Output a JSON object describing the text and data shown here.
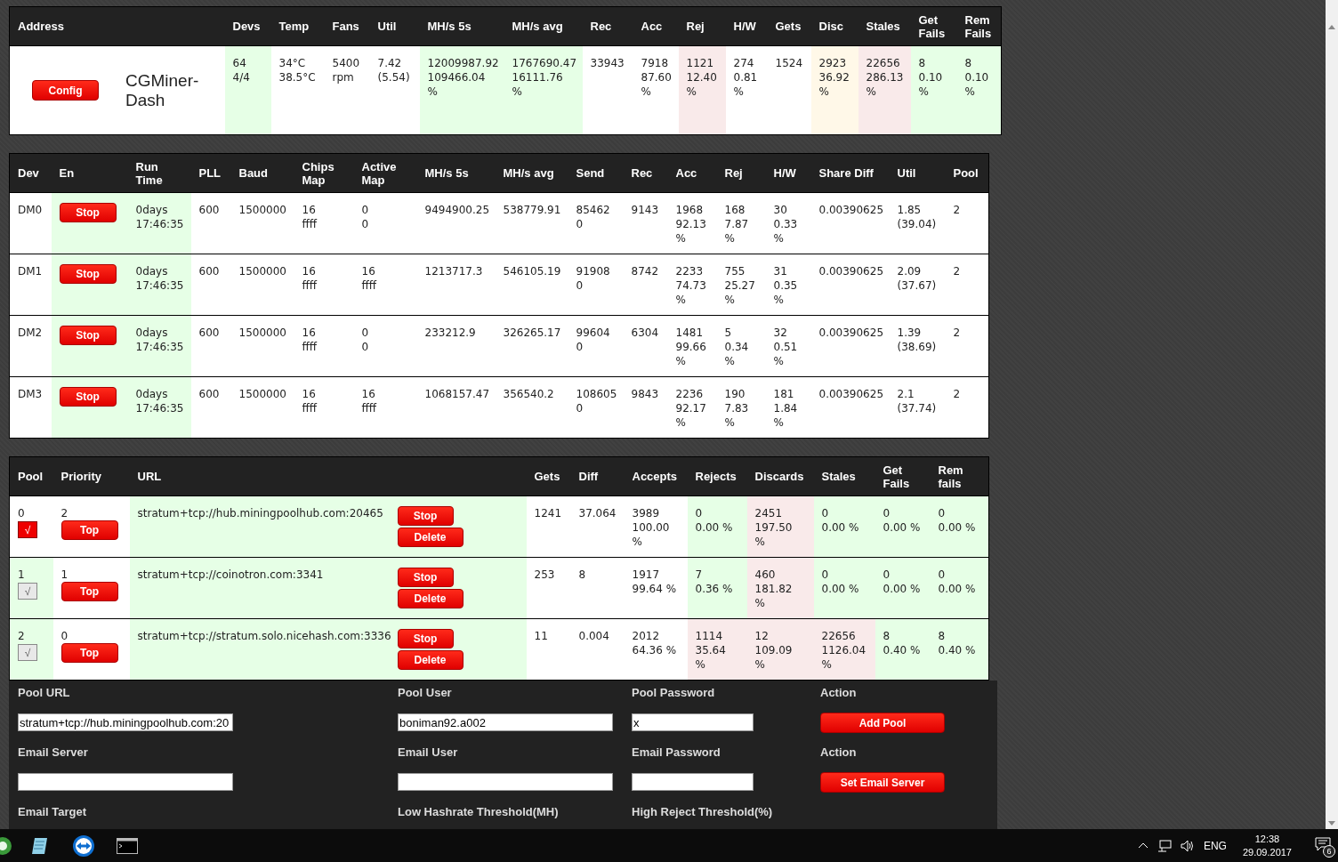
{
  "summary": {
    "config_button": "Config",
    "title": "CGMiner-Dash",
    "columns": [
      "Address",
      "Devs",
      "Temp",
      "Fans",
      "Util",
      "MH/s 5s",
      "MH/s avg",
      "Rec",
      "Acc",
      "Rej",
      "H/W",
      "Gets",
      "Disc",
      "Stales",
      "Get\nFails",
      "Rem\nFails"
    ],
    "cells": [
      {
        "text": "64\n4/4",
        "color": "#e6ffe6"
      },
      {
        "text": "34°C\n38.5°C"
      },
      {
        "text": "5400\nrpm"
      },
      {
        "text": "7.42\n(5.54)"
      },
      {
        "text": "12009987.92\n109466.04\n%",
        "color": "#e6ffe6"
      },
      {
        "text": "1767690.47\n16111.76\n%",
        "color": "#e6ffe6"
      },
      {
        "text": "33943"
      },
      {
        "text": "7918\n87.60\n%"
      },
      {
        "text": "1121\n12.40\n%",
        "color": "#f9eaea"
      },
      {
        "text": "274\n0.81\n%"
      },
      {
        "text": "1524"
      },
      {
        "text": "2923\n36.92\n%",
        "color": "#fff8e8"
      },
      {
        "text": "22656\n286.13\n%",
        "color": "#f9eaea"
      },
      {
        "text": "8\n0.10\n%",
        "color": "#e6ffe6"
      },
      {
        "text": "8\n0.10\n%",
        "color": "#e6ffe6"
      }
    ]
  },
  "devices": {
    "columns": [
      "Dev",
      "En",
      "Run\nTime",
      "PLL",
      "Baud",
      "Chips\nMap",
      "Active\nMap",
      "MH/s 5s",
      "MH/s avg",
      "Send",
      "Rec",
      "Acc",
      "Rej",
      "H/W",
      "Share Diff",
      "Util",
      "Pool"
    ],
    "rows": [
      {
        "cells": [
          {
            "text": "DM0"
          },
          {
            "button": "Stop",
            "color": "#e6ffe6"
          },
          {
            "text": "0days\n17:46:35",
            "color": "#e6ffe6"
          },
          {
            "text": "600"
          },
          {
            "text": "1500000"
          },
          {
            "text": "16\nffff"
          },
          {
            "text": "0\n0"
          },
          {
            "text": "9494900.25"
          },
          {
            "text": "538779.91"
          },
          {
            "text": "85462\n0"
          },
          {
            "text": "9143"
          },
          {
            "text": "1968\n92.13\n%"
          },
          {
            "text": "168\n7.87\n%"
          },
          {
            "text": "30\n0.33\n%"
          },
          {
            "text": "0.00390625"
          },
          {
            "text": "1.85\n(39.04)"
          },
          {
            "text": "2"
          }
        ]
      },
      {
        "cells": [
          {
            "text": "DM1"
          },
          {
            "button": "Stop",
            "color": "#e6ffe6"
          },
          {
            "text": "0days\n17:46:35",
            "color": "#e6ffe6"
          },
          {
            "text": "600"
          },
          {
            "text": "1500000"
          },
          {
            "text": "16\nffff"
          },
          {
            "text": "16\nffff"
          },
          {
            "text": "1213717.3"
          },
          {
            "text": "546105.19"
          },
          {
            "text": "91908\n0"
          },
          {
            "text": "8742"
          },
          {
            "text": "2233\n74.73\n%"
          },
          {
            "text": "755\n25.27\n%"
          },
          {
            "text": "31\n0.35\n%"
          },
          {
            "text": "0.00390625"
          },
          {
            "text": "2.09\n(37.67)"
          },
          {
            "text": "2"
          }
        ]
      },
      {
        "cells": [
          {
            "text": "DM2"
          },
          {
            "button": "Stop",
            "color": "#e6ffe6"
          },
          {
            "text": "0days\n17:46:35",
            "color": "#e6ffe6"
          },
          {
            "text": "600"
          },
          {
            "text": "1500000"
          },
          {
            "text": "16\nffff"
          },
          {
            "text": "0\n0"
          },
          {
            "text": "233212.9"
          },
          {
            "text": "326265.17"
          },
          {
            "text": "99604\n0"
          },
          {
            "text": "6304"
          },
          {
            "text": "1481\n99.66\n%"
          },
          {
            "text": "5\n0.34\n%"
          },
          {
            "text": "32\n0.51\n%"
          },
          {
            "text": "0.00390625"
          },
          {
            "text": "1.39\n(38.69)"
          },
          {
            "text": "2"
          }
        ]
      },
      {
        "cells": [
          {
            "text": "DM3"
          },
          {
            "button": "Stop",
            "color": "#e6ffe6"
          },
          {
            "text": "0days\n17:46:35",
            "color": "#e6ffe6"
          },
          {
            "text": "600"
          },
          {
            "text": "1500000"
          },
          {
            "text": "16\nffff"
          },
          {
            "text": "16\nffff"
          },
          {
            "text": "1068157.47"
          },
          {
            "text": "356540.2"
          },
          {
            "text": "108605\n0"
          },
          {
            "text": "9843"
          },
          {
            "text": "2236\n92.17\n%"
          },
          {
            "text": "190\n7.83\n%"
          },
          {
            "text": "181\n1.84\n%"
          },
          {
            "text": "0.00390625"
          },
          {
            "text": "2.1\n(37.74)"
          },
          {
            "text": "2"
          }
        ]
      }
    ]
  },
  "pools": {
    "columns": [
      "Pool",
      "Priority",
      "URL",
      "Gets",
      "Diff",
      "Accepts",
      "Rejects",
      "Discards",
      "Stales",
      "Get\nFails",
      "Rem\nfails"
    ],
    "rows": [
      {
        "cells": [
          {
            "text": "0",
            "toggle": {
              "label": "√",
              "selected": true
            }
          },
          {
            "text": "2",
            "button": "Top"
          },
          {
            "text": "stratum+tcp://hub.miningpoolhub.com:20465",
            "buttons": [
              "Stop",
              "Delete"
            ],
            "color": "#e6ffe6"
          },
          {
            "text": "1241"
          },
          {
            "text": "37.064"
          },
          {
            "text": "3989\n100.00\n%"
          },
          {
            "text": "0\n0.00 %",
            "color": "#e6ffe6"
          },
          {
            "text": "2451\n197.50\n%",
            "color": "#f9eaea"
          },
          {
            "text": "0\n0.00 %",
            "color": "#e6ffe6"
          },
          {
            "text": "0\n0.00 %",
            "color": "#e6ffe6"
          },
          {
            "text": "0\n0.00 %",
            "color": "#e6ffe6"
          }
        ]
      },
      {
        "cells": [
          {
            "text": "1",
            "toggle": {
              "label": "√",
              "selected": false
            },
            "color": "#e6ffe6"
          },
          {
            "text": "1",
            "button": "Top"
          },
          {
            "text": "stratum+tcp://coinotron.com:3341",
            "buttons": [
              "Stop",
              "Delete"
            ],
            "color": "#e6ffe6"
          },
          {
            "text": "253"
          },
          {
            "text": "8"
          },
          {
            "text": "1917\n99.64 %"
          },
          {
            "text": "7\n0.36 %",
            "color": "#e6ffe6"
          },
          {
            "text": "460\n181.82\n%",
            "color": "#f9eaea"
          },
          {
            "text": "0\n0.00 %",
            "color": "#e6ffe6"
          },
          {
            "text": "0\n0.00 %",
            "color": "#e6ffe6"
          },
          {
            "text": "0\n0.00 %",
            "color": "#e6ffe6"
          }
        ]
      },
      {
        "cells": [
          {
            "text": "2",
            "toggle": {
              "label": "√",
              "selected": false
            },
            "color": "#e6ffe6"
          },
          {
            "text": "0",
            "button": "Top"
          },
          {
            "text": "stratum+tcp://stratum.solo.nicehash.com:3336",
            "buttons": [
              "Stop",
              "Delete"
            ],
            "color": "#e6ffe6"
          },
          {
            "text": "11"
          },
          {
            "text": "0.004"
          },
          {
            "text": "2012\n64.36 %"
          },
          {
            "text": "1114\n35.64\n%",
            "color": "#f9eaea"
          },
          {
            "text": "12\n109.09\n%",
            "color": "#f9eaea"
          },
          {
            "text": "22656\n1126.04\n%",
            "color": "#f9eaea"
          },
          {
            "text": "8\n0.40 %",
            "color": "#e6ffe6"
          },
          {
            "text": "8\n0.40 %",
            "color": "#e6ffe6"
          }
        ]
      }
    ]
  },
  "form": [
    [
      {
        "label": "Pool URL",
        "kind": "input",
        "value": "stratum+tcp://hub.miningpoolhub.com:20"
      },
      {
        "label": "Pool User",
        "kind": "input",
        "value": "boniman92.a002"
      },
      {
        "label": "Pool Password",
        "kind": "input",
        "value": "x"
      },
      {
        "label": "Action",
        "kind": "button",
        "button": "Add Pool"
      }
    ],
    [
      {
        "label": "Email Server",
        "kind": "input"
      },
      {
        "label": "Email User",
        "kind": "input"
      },
      {
        "label": "Email Password",
        "kind": "input"
      },
      {
        "label": "Action",
        "kind": "button",
        "button": "Set Email Server"
      }
    ],
    [
      {
        "label": "Email Target",
        "kind": "cut"
      },
      {
        "label": "Low Hashrate Threshold(MH)",
        "kind": "cut"
      },
      {
        "label": "High Reject Threshold(%)",
        "kind": "cut"
      }
    ]
  ],
  "taskbar": {
    "language": "ENG",
    "time": "12:38",
    "date": "29.09.2017",
    "notifications": "6"
  }
}
